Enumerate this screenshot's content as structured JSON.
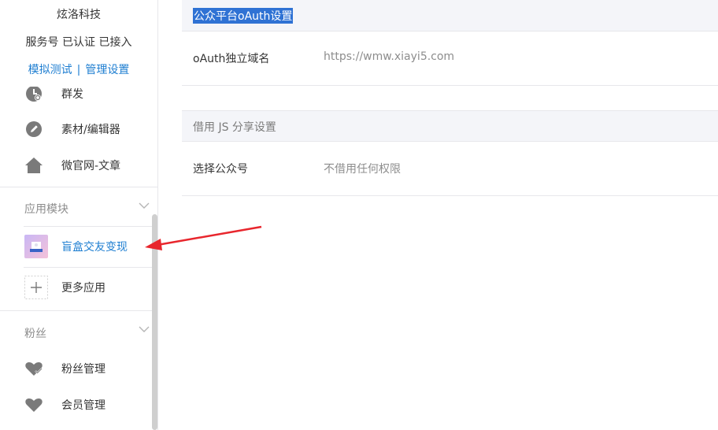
{
  "account": {
    "name": "炫洛科技",
    "status": "服务号 已认证 已接入",
    "link_test": "模拟测试",
    "link_sep": "|",
    "link_manage": "管理设置"
  },
  "menu": {
    "group_send": "群发",
    "material": "素材/编辑器",
    "micro_site": "微官网-文章",
    "apps_section": "应用模块",
    "blind_box": "盲盒交友变现",
    "more_apps": "更多应用",
    "fans_section": "粉丝",
    "fans_manage": "粉丝管理",
    "member_manage": "会员管理"
  },
  "main": {
    "oauth_title": "公众平台oAuth设置",
    "oauth_domain_label": "oAuth独立域名",
    "oauth_domain_value": "https://wmw.xiayi5.com",
    "js_title": "借用 JS 分享设置",
    "choose_label": "选择公众号",
    "choose_value": "不借用任何权限"
  },
  "colors": {
    "accent": "#1e7ed1",
    "selection": "#2f72d4",
    "arrow": "#e8262d",
    "section_bg": "#f4f5f9",
    "icon_gray": "#7a7a7a"
  },
  "icons": {
    "group_send": "clock-send-icon",
    "material": "pencil-circle-icon",
    "micro_site": "house-icon",
    "blind_box": "app-thumbnail-icon",
    "more_apps": "plus-icon",
    "fans_manage": "heart-check-icon",
    "member_manage": "heart-icon",
    "section_toggle": "chevron-down-icon"
  }
}
